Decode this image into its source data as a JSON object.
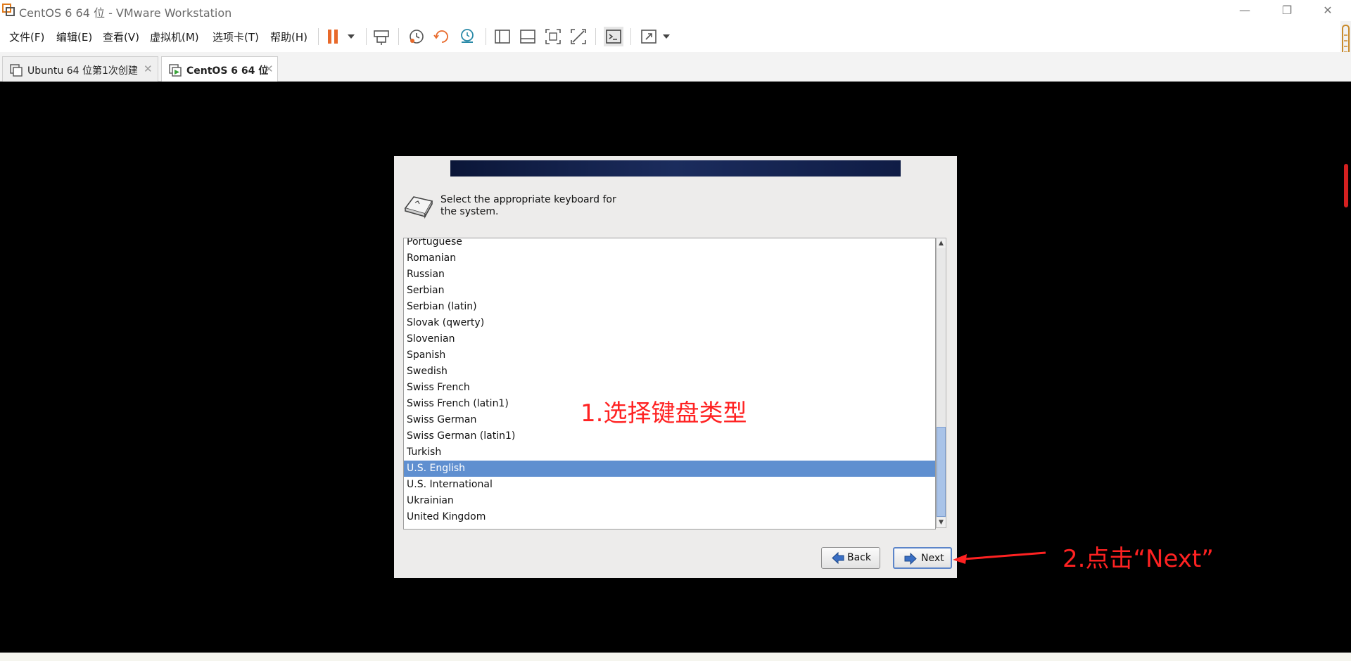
{
  "window": {
    "title": "CentOS 6 64 位 - VMware Workstation",
    "controls": {
      "minimize": "—",
      "restore": "❐",
      "close": "✕"
    }
  },
  "menu": [
    "文件(F)",
    "编辑(E)",
    "查看(V)",
    "虚拟机(M)",
    "选项卡(T)",
    "帮助(H)"
  ],
  "toolbar": {
    "icons": [
      "pause-icon",
      "dropdown-icon",
      "send-keys-icon",
      "snapshot-icon",
      "revert-snapshot-icon",
      "manage-snapshots-icon",
      "show-library-icon",
      "thumbnail-bar-icon",
      "full-screen-icon",
      "unity-icon",
      "console-view-icon",
      "stretch-icon"
    ]
  },
  "tabs": [
    {
      "label": "Ubuntu 64 位第1次创建",
      "active": false
    },
    {
      "label": "CentOS 6 64 位",
      "active": true
    }
  ],
  "installer": {
    "prompt": "Select the appropriate keyboard for the system.",
    "keyboards": [
      "Portuguese",
      "Romanian",
      "Russian",
      "Serbian",
      "Serbian (latin)",
      "Slovak (qwerty)",
      "Slovenian",
      "Spanish",
      "Swedish",
      "Swiss French",
      "Swiss French (latin1)",
      "Swiss German",
      "Swiss German (latin1)",
      "Turkish",
      "U.S. English",
      "U.S. International",
      "Ukrainian",
      "United Kingdom"
    ],
    "selected": "U.S. English",
    "back_label": "Back",
    "next_label": "Next"
  },
  "annotations": {
    "step1": "1.选择键盘类型",
    "step2": "2.点击“Next”"
  },
  "colors": {
    "selection": "#5f8fd0",
    "annotation": "#ff2222",
    "pause_orange": "#e8692a"
  }
}
